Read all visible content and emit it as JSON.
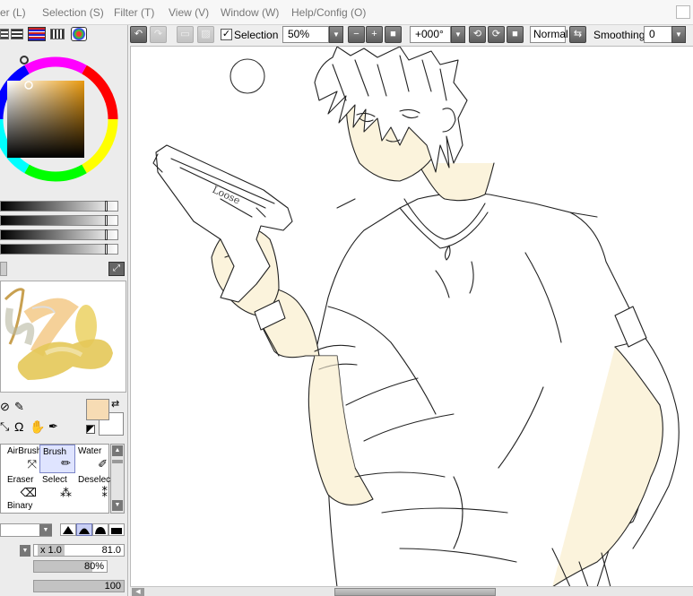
{
  "menubar": {
    "items": [
      "er (L)",
      "Selection (S)",
      "Filter (T)",
      "View (V)",
      "Window (W)",
      "Help/Config (O)"
    ]
  },
  "toolbar": {
    "selection_label": "Selection",
    "selection_checked": "✓",
    "zoom_value": "50%",
    "rotation_value": "+000°",
    "blend_mode": "Normal",
    "smoothing_label": "Smoothing",
    "smoothing_value": "0"
  },
  "tools": {
    "airbrush_label": "AirBrush",
    "brush_label": "Brush",
    "water_label": "Water",
    "eraser_label": "Eraser",
    "select_label": "Select",
    "deselect_label": "Deselect",
    "binary_label": "Binary"
  },
  "brush_params": {
    "size_multiplier": "x 1.0",
    "size_value": "81.0",
    "density_value": "80%",
    "density_fraction": 0.8,
    "opacity_value": "100",
    "opacity_fraction": 1.0
  },
  "colors": {
    "primary": "#f7dcb4",
    "secondary": "#ffffff",
    "skin_fill": "#fbf3dc",
    "accent_orange": "#c07a3c"
  },
  "icons": {
    "undo": "undo-icon",
    "redo": "redo-icon",
    "rotate_left": "rotate-left-icon",
    "rotate_right": "rotate-right-icon",
    "flip": "flip-icon"
  }
}
